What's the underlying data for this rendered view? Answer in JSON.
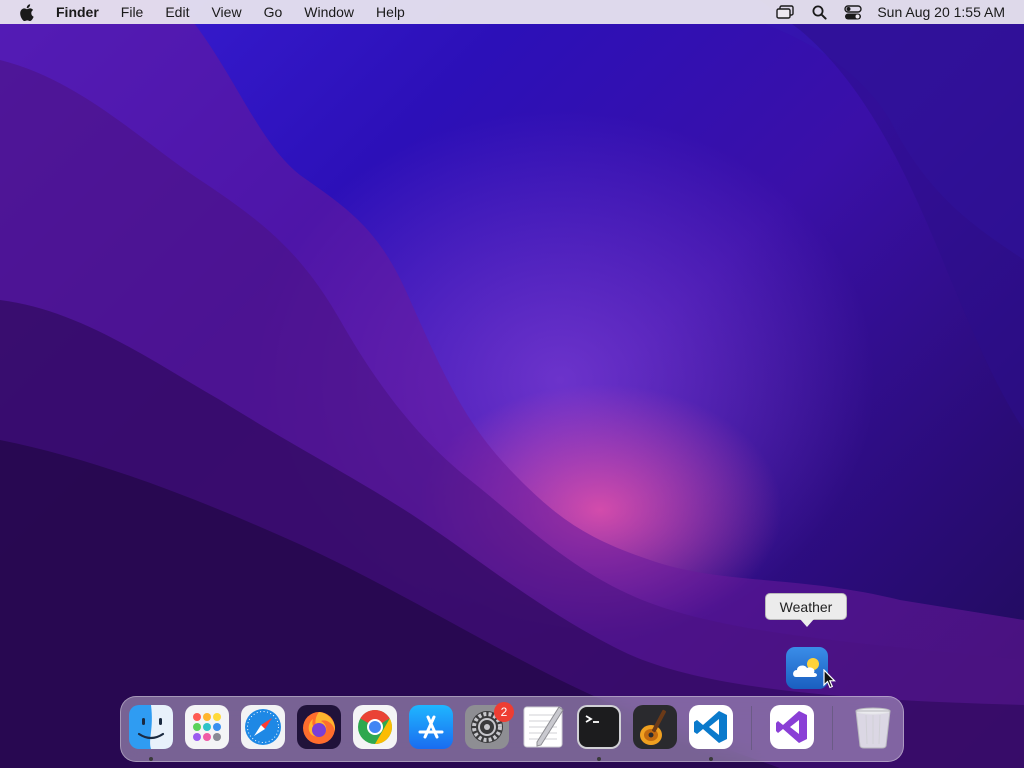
{
  "menubar": {
    "app_name": "Finder",
    "menus": [
      "File",
      "Edit",
      "View",
      "Go",
      "Window",
      "Help"
    ],
    "clock": "Sun Aug 20  1:55 AM",
    "status_icons": [
      "screen-mirroring-icon",
      "search-icon",
      "control-center-icon"
    ]
  },
  "tooltip": {
    "label": "Weather"
  },
  "dock": {
    "apps": [
      {
        "name": "Finder",
        "icon": "finder-icon",
        "running": true
      },
      {
        "name": "Launchpad",
        "icon": "launchpad-icon",
        "running": false
      },
      {
        "name": "Safari",
        "icon": "safari-icon",
        "running": false
      },
      {
        "name": "Firefox",
        "icon": "firefox-icon",
        "running": false
      },
      {
        "name": "Google Chrome",
        "icon": "chrome-icon",
        "running": false
      },
      {
        "name": "App Store",
        "icon": "app-store-icon",
        "running": false
      },
      {
        "name": "System Settings",
        "icon": "system-settings-icon",
        "running": false,
        "badge": "2"
      },
      {
        "name": "TextEdit",
        "icon": "textedit-icon",
        "running": false
      },
      {
        "name": "Terminal",
        "icon": "terminal-icon",
        "running": true
      },
      {
        "name": "GarageBand",
        "icon": "garageband-icon",
        "running": false
      },
      {
        "name": "Visual Studio Code",
        "icon": "vscode-icon",
        "running": true
      },
      {
        "name": "Visual Studio",
        "icon": "visual-studio-icon",
        "running": false
      },
      {
        "name": "Trash",
        "icon": "trash-icon",
        "running": false
      }
    ]
  },
  "colors": {
    "menubar_bg": "#ece8f0",
    "badge": "#ee3d32",
    "vscode_blue": "#0a7acc",
    "vs_purple": "#8a3fd6"
  }
}
